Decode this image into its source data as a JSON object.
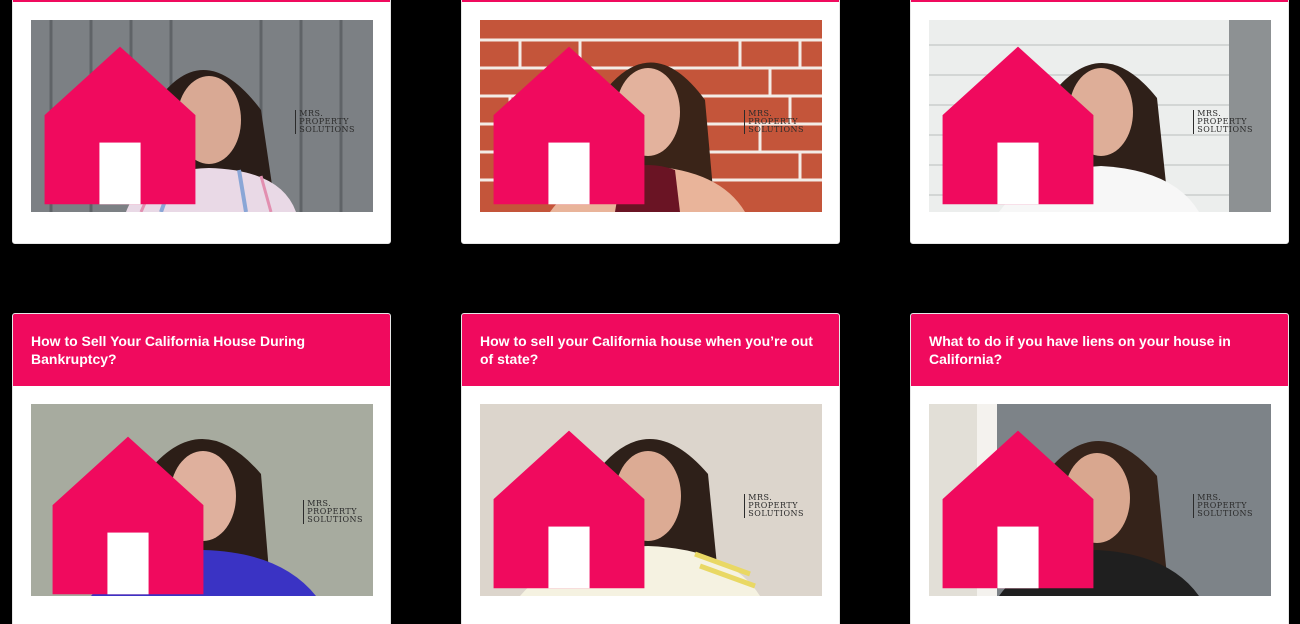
{
  "colors": {
    "accent": "#f00a5e",
    "background": "#000000",
    "card": "#ffffff"
  },
  "logo": {
    "line1": "MRS.",
    "line2": "PROPERTY",
    "line3": "SOLUTIONS",
    "icon": "house-logo-icon"
  },
  "top_cards": [
    {
      "thumb": "video-thumbnail",
      "bg": "gray-wood-wall",
      "shirt": "striped-shirt"
    },
    {
      "thumb": "video-thumbnail",
      "bg": "red-brick-wall",
      "shirt": "maroon-top"
    },
    {
      "thumb": "video-thumbnail",
      "bg": "white-siding-wall",
      "shirt": "white-shirt"
    }
  ],
  "bottom_cards": [
    {
      "title": "How to Sell Your California House During Bankruptcy?",
      "bg": "sage-wall",
      "shirt": "blue-top"
    },
    {
      "title": "How to sell your California house when you’re out of state?",
      "bg": "beige-wall",
      "shirt": "yellow-striped-top"
    },
    {
      "title": "What to do if you have liens on your house in California?",
      "bg": "gray-door",
      "shirt": "black-top"
    }
  ]
}
